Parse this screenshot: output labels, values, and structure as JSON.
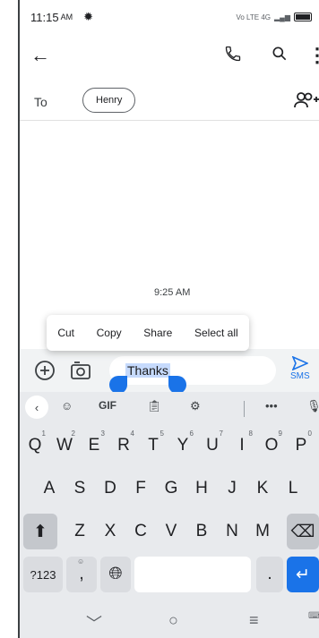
{
  "status": {
    "time": "11:15",
    "ampm": "AM",
    "network": "Vo LTE 4G"
  },
  "toolbar": {
    "back": "←",
    "more": "⋮"
  },
  "recipient": {
    "label": "To",
    "name": "Henry"
  },
  "conversation": {
    "timestamp": "9:25 AM"
  },
  "context_menu": [
    "Cut",
    "Copy",
    "Share",
    "Select all"
  ],
  "compose": {
    "text": "Thanks",
    "send_label": "SMS"
  },
  "keyboard": {
    "toolbar": {
      "gif": "GIF",
      "more": "•••"
    },
    "row1": [
      {
        "k": "Q",
        "n": "1"
      },
      {
        "k": "W",
        "n": "2"
      },
      {
        "k": "E",
        "n": "3"
      },
      {
        "k": "R",
        "n": "4"
      },
      {
        "k": "T",
        "n": "5"
      },
      {
        "k": "Y",
        "n": "6"
      },
      {
        "k": "U",
        "n": "7"
      },
      {
        "k": "I",
        "n": "8"
      },
      {
        "k": "O",
        "n": "9"
      },
      {
        "k": "P",
        "n": "0"
      }
    ],
    "row2": [
      "A",
      "S",
      "D",
      "F",
      "G",
      "H",
      "J",
      "K",
      "L"
    ],
    "row3": [
      "Z",
      "X",
      "C",
      "V",
      "B",
      "N",
      "M"
    ],
    "symbols": "?123",
    "comma": ",",
    "period": "."
  },
  "colors": {
    "accent": "#1a73e8",
    "selection": "#c6dafc",
    "keyboard_bg": "#e8eaed"
  }
}
